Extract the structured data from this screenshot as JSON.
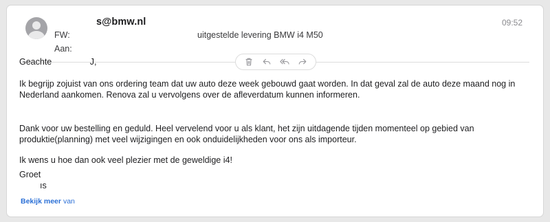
{
  "email": {
    "sender_partial": "s@bmw.nl",
    "time": "09:52",
    "subject_label": "FW:",
    "subject_tail": "uitgestelde levering BMW i4 M50",
    "to_label": "Aan:",
    "greeting_word": "Geachte",
    "greeting_tail": "J,",
    "paragraph_1": "Ik begrijp zojuist van ons ordering team dat uw auto deze week gebouwd gaat worden. In dat geval zal de auto deze maand nog in Nederland aankomen. Renova zal u vervolgens over de afleverdatum kunnen informeren.",
    "paragraph_2": "Dank voor uw bestelling en geduld. Heel vervelend voor u als klant, het zijn uitdagende tijden momenteel op gebied van produktie(planning) met veel wijzigingen en ook onduidelijkheden voor ons als importeur.",
    "paragraph_3": "Ik wens u hoe dan ook veel plezier met de geweldige i4!",
    "signoff": "Groet",
    "signature_partial": "ıs",
    "see_more": "Bekijk meer",
    "see_more_suffix": "van"
  },
  "actions": [
    {
      "icon": "trash-icon"
    },
    {
      "icon": "reply-icon"
    },
    {
      "icon": "reply-all-icon"
    },
    {
      "icon": "forward-icon"
    }
  ]
}
